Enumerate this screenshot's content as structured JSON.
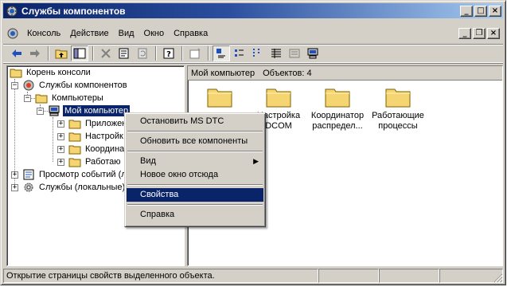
{
  "window": {
    "title": "Службы компонентов",
    "icon": "component-services-icon"
  },
  "menubar": {
    "items": [
      "Консоль",
      "Действие",
      "Вид",
      "Окно",
      "Справка"
    ]
  },
  "title_buttons": {
    "minimize": "_",
    "maximize": "□",
    "close": "×"
  },
  "mdi_buttons": {
    "minimize": "_",
    "restore": "❐",
    "close": "×"
  },
  "toolbar": {
    "buttons": [
      "back",
      "forward",
      "up-one-level",
      "show-hide-tree",
      "delete",
      "properties",
      "refresh",
      "help",
      "new-window",
      "large-icons",
      "small-icons",
      "list",
      "details",
      "configure",
      "computer"
    ]
  },
  "tree": {
    "items": [
      {
        "label": "Корень консоли"
      },
      {
        "label": "Службы компонентов"
      },
      {
        "label": "Компьютеры"
      },
      {
        "label": "Мой компьютер"
      },
      {
        "label": "Приложен"
      },
      {
        "label": "Настройк"
      },
      {
        "label": "Координа"
      },
      {
        "label": "Работаю"
      },
      {
        "label": "Просмотр событий (л"
      },
      {
        "label": "Службы (локальные)"
      }
    ]
  },
  "right_pane": {
    "header_location": "Мой компьютер",
    "header_count": "Объектов: 4",
    "items": [
      {
        "label_line1": "",
        "label_line2": ""
      },
      {
        "label_line1": "Настройка",
        "label_line2": "DCOM"
      },
      {
        "label_line1": "Координатор",
        "label_line2": "распредел..."
      },
      {
        "label_line1": "Работающие",
        "label_line2": "процессы"
      }
    ]
  },
  "context_menu": {
    "items": [
      {
        "label": "Остановить MS DTC"
      },
      {
        "label": "Обновить все компоненты"
      },
      {
        "label": "Вид"
      },
      {
        "label": "Новое окно отсюда"
      },
      {
        "label": "Свойства"
      },
      {
        "label": "Справка"
      }
    ]
  },
  "statusbar": {
    "text": "Открытие страницы свойств выделенного объекта."
  },
  "colors": {
    "title_start": "#0a246a",
    "title_end": "#a6caf0",
    "selection": "#0a246a",
    "face": "#d4d0c8",
    "folder": "#f5d572"
  }
}
